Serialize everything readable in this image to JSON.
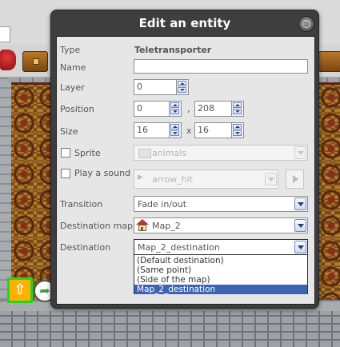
{
  "dialog": {
    "title": "Edit an entity",
    "type_label": "Type",
    "type_value": "Teletransporter",
    "name_label": "Name",
    "name_value": "",
    "layer_label": "Layer",
    "layer_value": "0",
    "position_label": "Position",
    "position_x": "0",
    "position_sep": ",",
    "position_y": "208",
    "size_label": "Size",
    "size_w": "16",
    "size_sep": "x",
    "size_h": "16",
    "sprite_label": "Sprite",
    "sprite_checked": false,
    "sprite_value": "animals",
    "sound_label": "Play a sound",
    "sound_checked": false,
    "sound_value": "arrow_hit",
    "transition_label": "Transition",
    "transition_value": "Fade in/out",
    "destination_map_label": "Destination map",
    "destination_map_value": "Map_2",
    "destination_label": "Destination",
    "destination_value": "Map_2_destination",
    "destination_options": [
      "(Default destination)",
      "(Same point)",
      "(Side of the map)",
      "Map_2_destination"
    ],
    "destination_selected_index": 3
  },
  "icons": {
    "close": "close-circle-icon",
    "folder": "folder-icon",
    "sound": "speaker-icon",
    "play": "play-icon",
    "map": "house-icon",
    "teletransporter": "up-arrow-icon",
    "destination": "destination-arrow-icon"
  },
  "colors": {
    "title_bar": "#3e3e3e",
    "selection": "#3b64b4",
    "entity_highlight": "#22d622",
    "teletransporter_fill": "#ffb000"
  }
}
